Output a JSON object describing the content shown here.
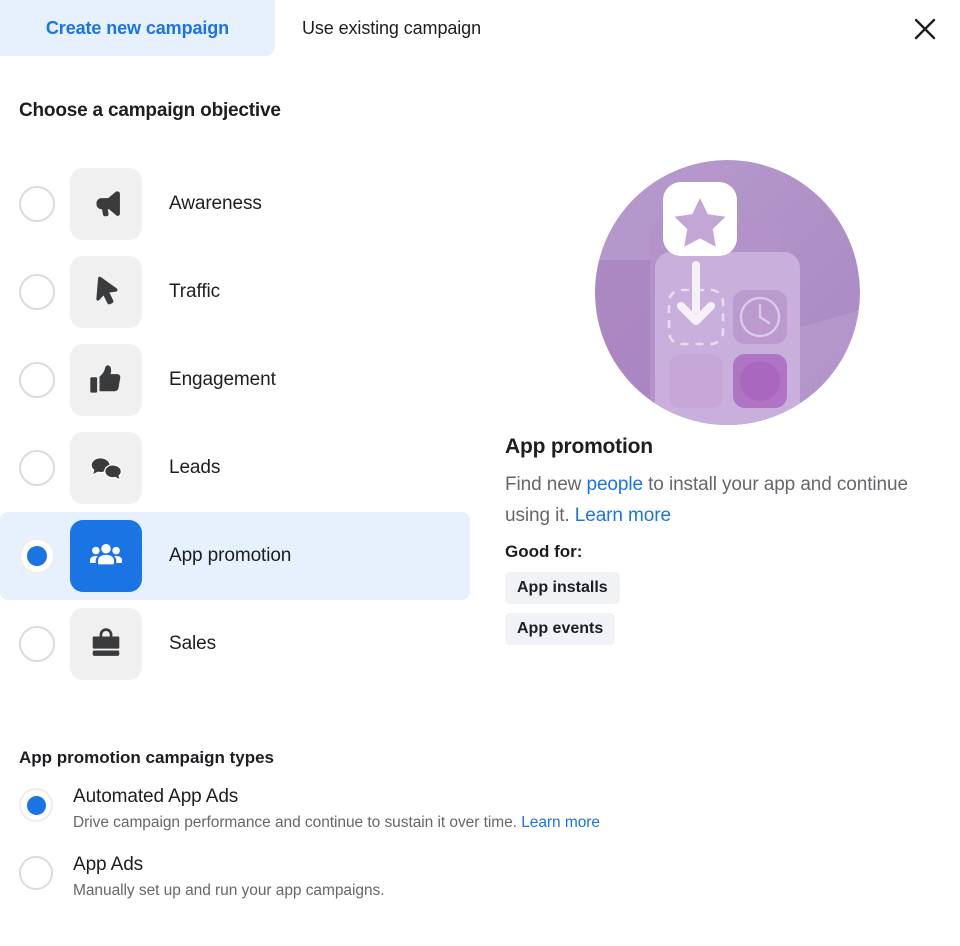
{
  "tabs": [
    {
      "id": "create-new",
      "label": "Create new campaign",
      "active": true
    },
    {
      "id": "use-existing",
      "label": "Use existing campaign",
      "active": false
    }
  ],
  "close_icon": "close-icon",
  "objective_section": {
    "heading": "Choose a campaign objective",
    "options": [
      {
        "id": "awareness",
        "label": "Awareness",
        "icon": "megaphone-icon",
        "selected": false
      },
      {
        "id": "traffic",
        "label": "Traffic",
        "icon": "cursor-icon",
        "selected": false
      },
      {
        "id": "engagement",
        "label": "Engagement",
        "icon": "thumbs-up-icon",
        "selected": false
      },
      {
        "id": "leads",
        "label": "Leads",
        "icon": "speech-bubbles-icon",
        "selected": false
      },
      {
        "id": "app-promotion",
        "label": "App promotion",
        "icon": "people-group-icon",
        "selected": true
      },
      {
        "id": "sales",
        "label": "Sales",
        "icon": "shopping-bag-icon",
        "selected": false
      }
    ]
  },
  "detail": {
    "illustration": "app-promotion-illustration",
    "title": "App promotion",
    "description_part1": "Find new ",
    "description_link1": "people",
    "description_part2": " to install your app and continue using it. ",
    "description_link2": "Learn more",
    "good_for_label": "Good for:",
    "badges": [
      "App installs",
      "App events"
    ]
  },
  "campaign_types": {
    "heading": "App promotion campaign types",
    "options": [
      {
        "id": "automated-app-ads",
        "title": "Automated App Ads",
        "description": "Drive campaign performance and continue to sustain it over time. ",
        "link": "Learn more",
        "selected": true
      },
      {
        "id": "app-ads",
        "title": "App Ads",
        "description": "Manually set up and run your app campaigns.",
        "link": "",
        "selected": false
      }
    ]
  },
  "colors": {
    "accent_blue": "#1b74e4",
    "selected_row_bg": "#e7f0fd",
    "tile_bg": "#f0f0f0",
    "badge_bg": "#f0f2f5",
    "text_primary": "#1c1e21",
    "text_secondary": "#65676b",
    "illustration_purple": "#a98bc4"
  }
}
